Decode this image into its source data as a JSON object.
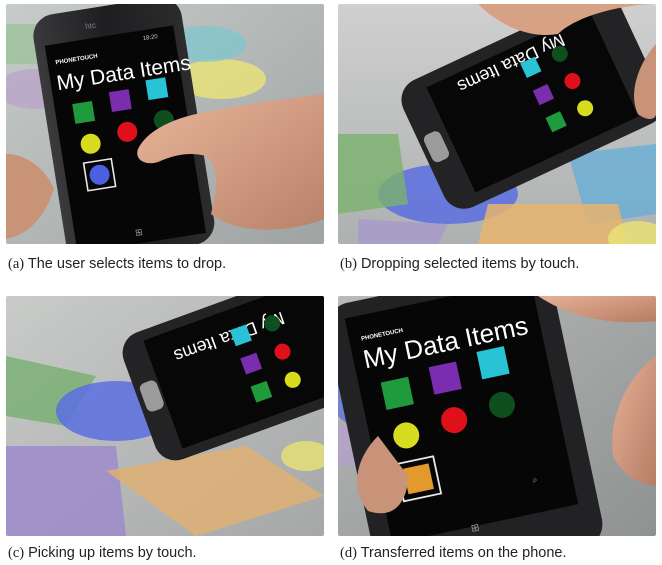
{
  "figure": {
    "panels": [
      {
        "id": "a",
        "label": "(a)",
        "caption": "The user selects items to drop."
      },
      {
        "id": "b",
        "label": "(b)",
        "caption": "Dropping selected items by touch."
      },
      {
        "id": "c",
        "label": "(c)",
        "caption": "Picking up items by touch."
      },
      {
        "id": "d",
        "label": "(d)",
        "caption": "Transferred items on the phone."
      }
    ],
    "phone_app": {
      "app_name": "PHONETOUCH",
      "page_title": "My Data Items",
      "brand": "htc",
      "clock": "18:20"
    },
    "colors": {
      "green": "#1f9a3c",
      "purple": "#7b2db0",
      "cyan": "#29c3d6",
      "yellow": "#d7dc1f",
      "red": "#e0101a",
      "dark_green": "#0f4f1e",
      "blue": "#4b5fe0",
      "orange": "#e39a2c"
    }
  }
}
